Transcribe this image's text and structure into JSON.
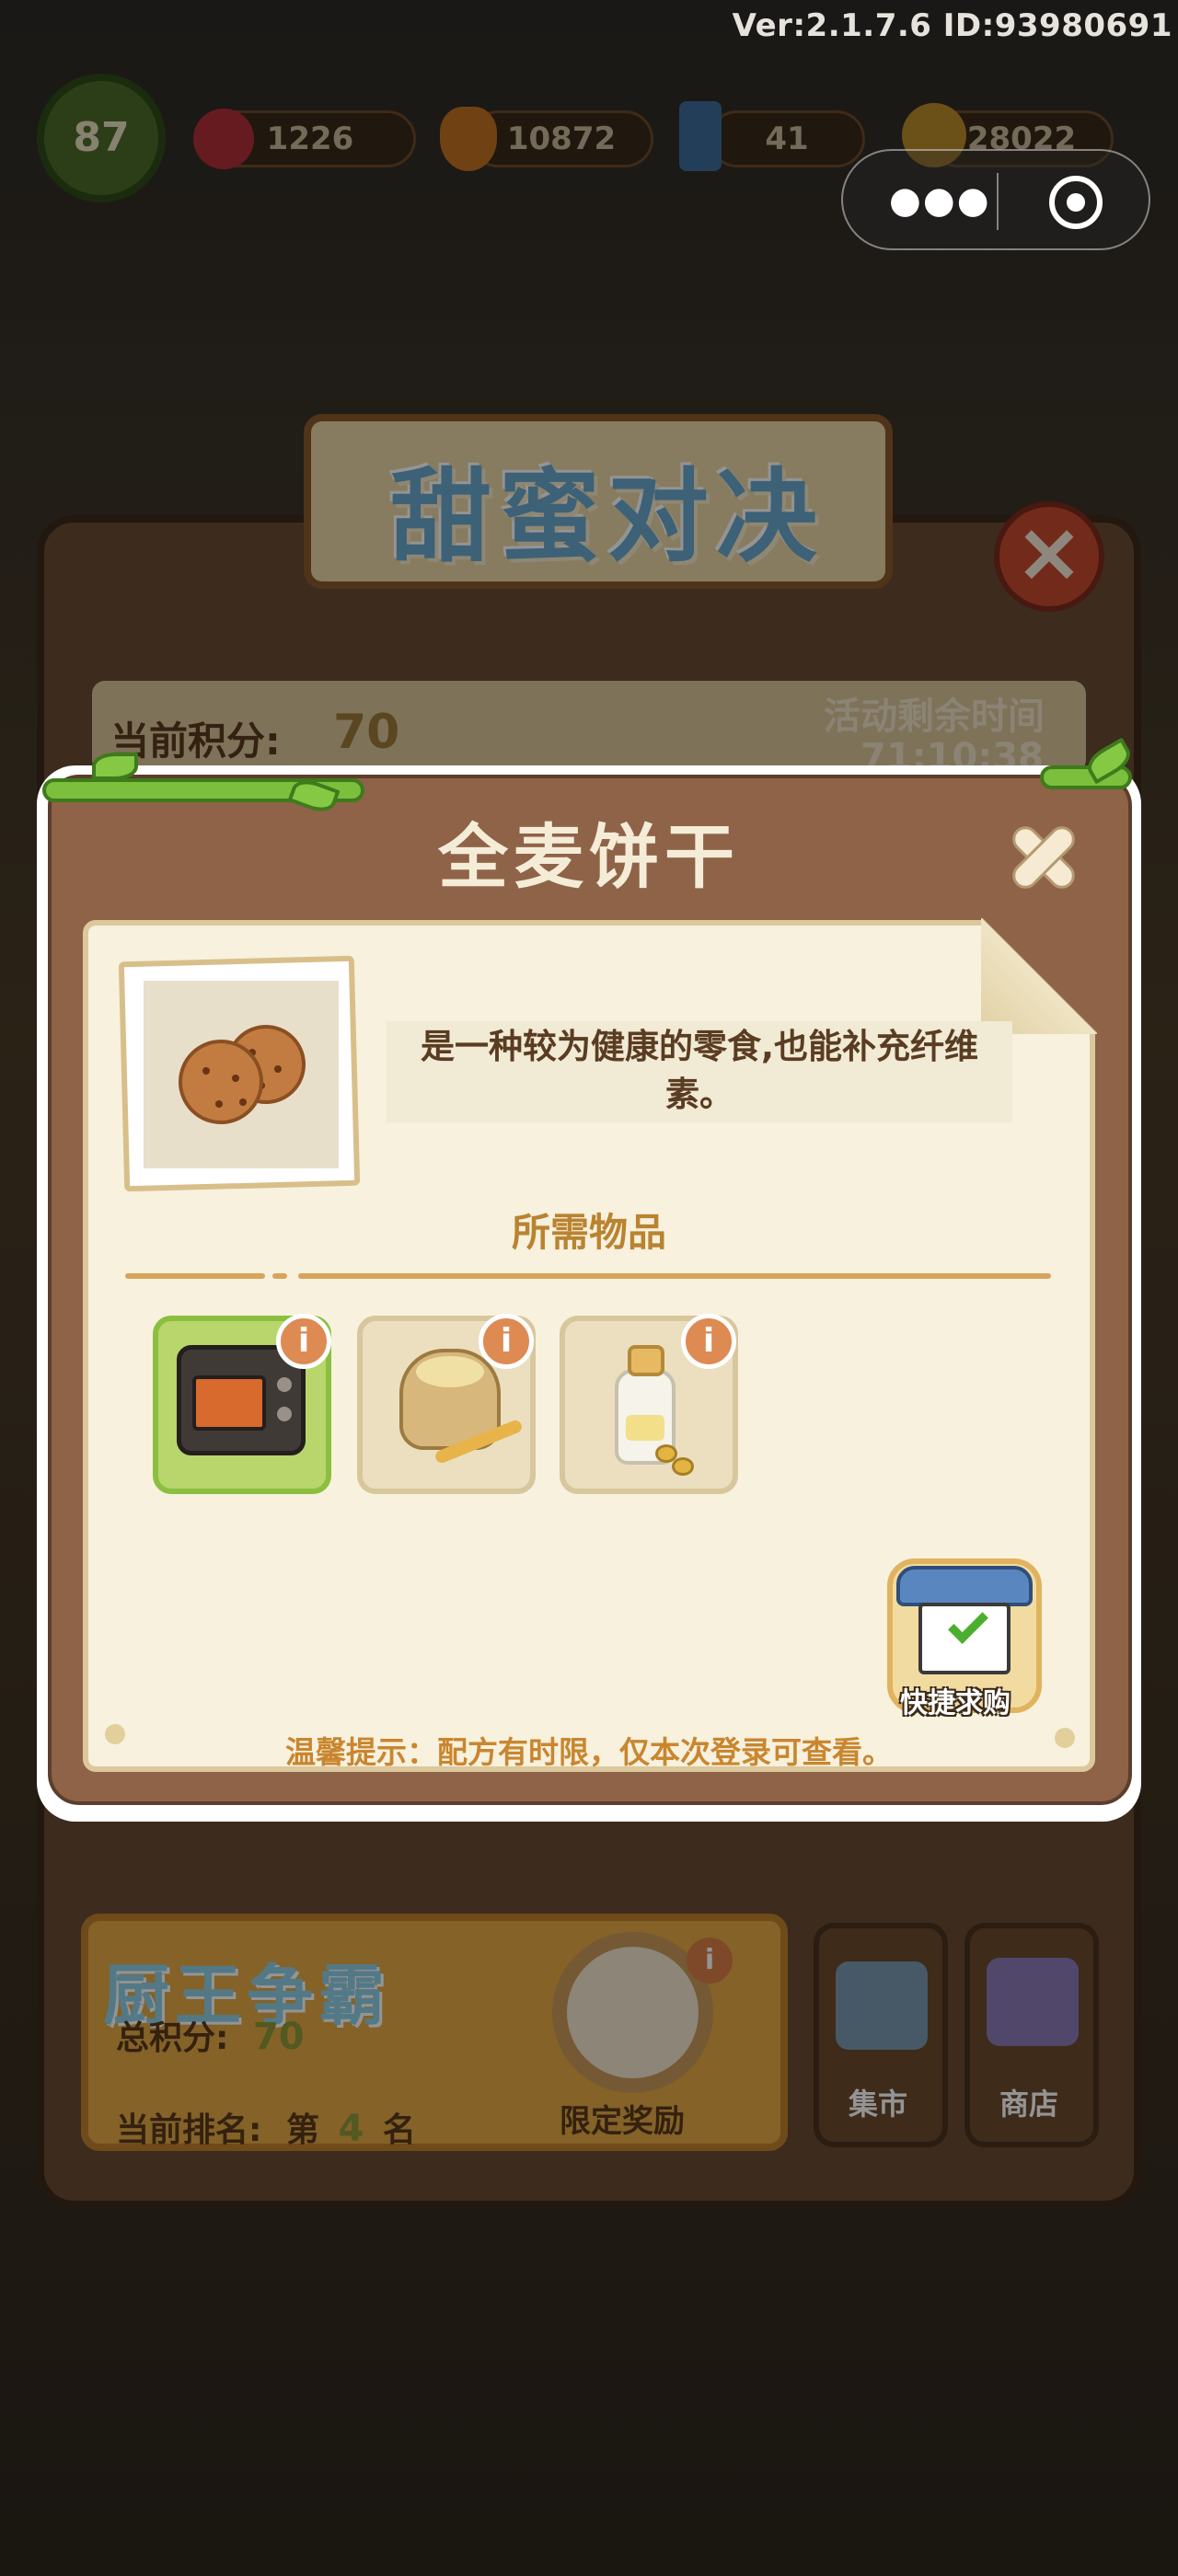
{
  "status_bar": {
    "version": "Ver:2.1.7.6 ID:93980691"
  },
  "mini_program_capsule": {
    "more_icon": "more-dots-icon",
    "close_icon": "target-circle-icon"
  },
  "background": {
    "player_level": "87",
    "resources": [
      {
        "icon": "gem-icon",
        "value": "1226"
      },
      {
        "icon": "carrot-icon",
        "value": "10872"
      },
      {
        "icon": "energy-icon",
        "value": "41"
      },
      {
        "icon": "coin-icon",
        "value": "28022"
      }
    ],
    "event": {
      "title": "甜蜜对决",
      "score_label": "当前积分:",
      "score_value": "70",
      "time_label": "活动剩余时间",
      "time_value": "71:10:38"
    },
    "chef_card": {
      "title": "厨王争霸",
      "total_label": "总积分:",
      "total_value": "70",
      "rank_label": "当前排名:",
      "rank_prefix": "第",
      "rank_value": "4",
      "rank_suffix": "名",
      "reward_label": "限定奖励",
      "info": "i"
    },
    "side_buttons": [
      {
        "label": "集市",
        "icon": "market-icon"
      },
      {
        "label": "商店",
        "icon": "shop-icon"
      }
    ]
  },
  "modal": {
    "title": "全麦饼干",
    "close_icon": "close-x-icon",
    "item_icon": "cookie-icon",
    "description": "是一种较为健康的零食,也能补充纤维素。",
    "required_title": "所需物品",
    "required_items": [
      {
        "icon": "oven-icon",
        "info": "i",
        "highlight": true
      },
      {
        "icon": "flour-sack-icon",
        "info": "i",
        "highlight": false
      },
      {
        "icon": "soy-milk-bottle-icon",
        "info": "i",
        "highlight": false
      }
    ],
    "shortcut_label": "快捷求购",
    "tip": "温馨提示：配方有时限，仅本次登录可查看。"
  }
}
